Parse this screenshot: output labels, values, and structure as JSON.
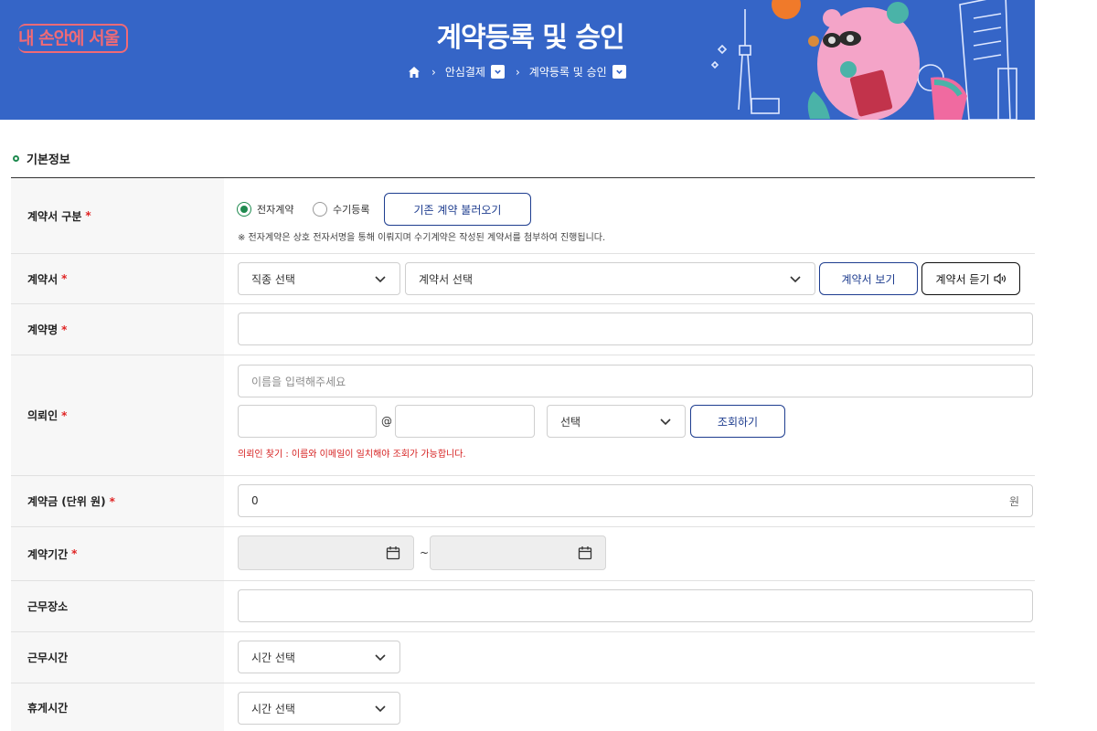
{
  "header": {
    "logo": "내 손안에 서울",
    "title": "계약등록 및 승인",
    "breadcrumb": [
      "안심결제",
      "계약등록 및 승인"
    ]
  },
  "section": {
    "title": "기본정보"
  },
  "form": {
    "contract_type": {
      "label": "계약서 구분",
      "options": [
        "전자계약",
        "수기등록"
      ],
      "selected": "전자계약",
      "load_button": "기존 계약 불러오기",
      "note": "※ 전자계약은 상호 전자서명을 통해 이뤄지며 수기계약은 작성된 계약서를 첨부하여 진행됩니다."
    },
    "contract_doc": {
      "label": "계약서",
      "job_select": "직종 선택",
      "doc_select": "계약서 선택",
      "view_button": "계약서 보기",
      "listen_button": "계약서 듣기"
    },
    "contract_name": {
      "label": "계약명",
      "value": ""
    },
    "client": {
      "label": "의뢰인",
      "name_placeholder": "이름을 입력해주세요",
      "email_local": "",
      "at": "@",
      "email_domain": "",
      "domain_select": "선택",
      "lookup_button": "조회하기",
      "note": "의뢰인 찾기 : 이름와 이메일이 일치해야 조회가 가능합니다."
    },
    "amount": {
      "label": "계약금 (단위 원)",
      "value": "0",
      "unit": "원"
    },
    "period": {
      "label": "계약기간",
      "separator": "~"
    },
    "workplace": {
      "label": "근무장소",
      "value": ""
    },
    "work_hours": {
      "label": "근무시간",
      "select": "시간 선택"
    },
    "break_time": {
      "label": "휴게시간",
      "select": "시간 선택"
    },
    "required_mark": "*"
  },
  "colors": {
    "banner": "#3565c7",
    "accent_green": "#1f8a4f",
    "required_red": "#e02424",
    "button_navy": "#1e3d8f"
  }
}
